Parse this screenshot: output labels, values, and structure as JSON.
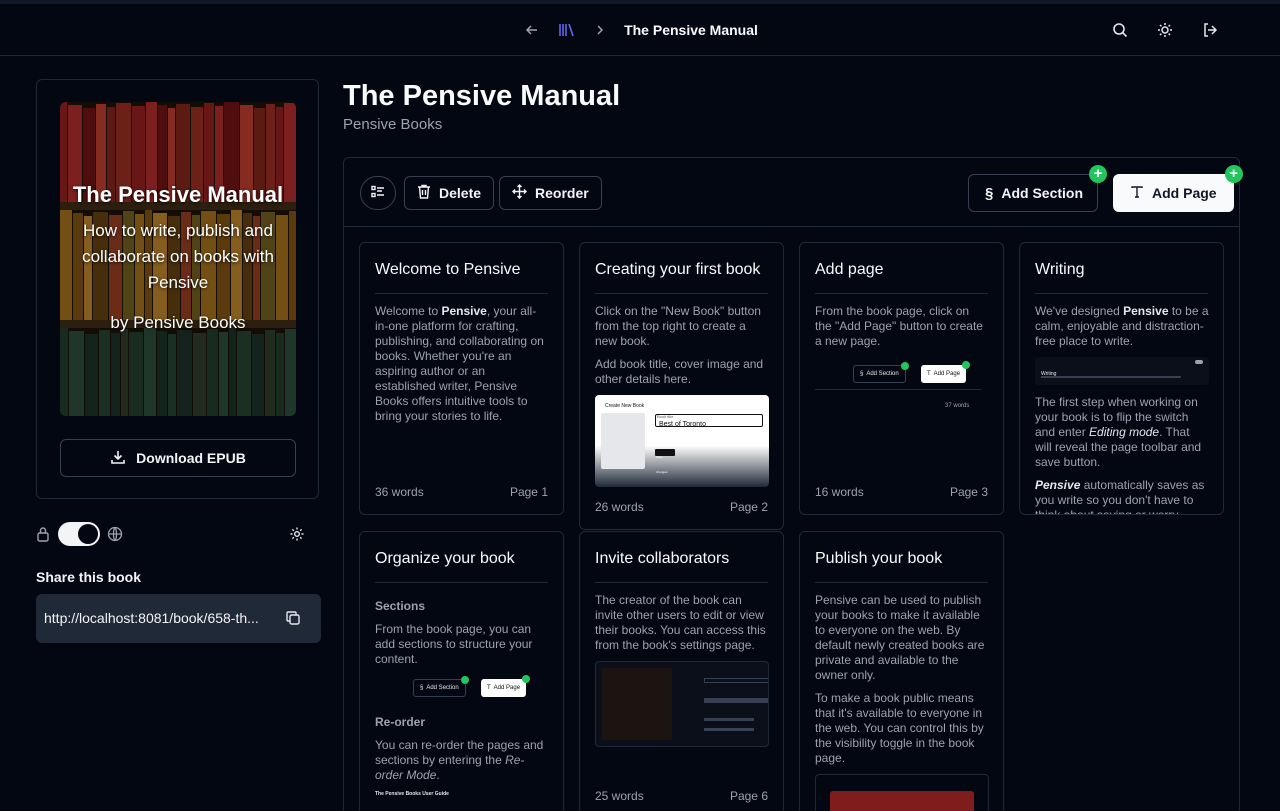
{
  "header": {
    "book_title": "The Pensive Manual",
    "icons": [
      "arrow-left-icon",
      "library-icon",
      "chevron-right-icon",
      "search-icon",
      "sun-icon",
      "logout-icon"
    ]
  },
  "sidebar": {
    "cover": {
      "title": "The Pensive Manual",
      "subtitle": "How to write, publish and collaborate on books with Pensive",
      "byline": "by Pensive Books"
    },
    "download_label": "Download EPUB",
    "share_label": "Share this book",
    "share_url": "http://localhost:8081/book/658-th..."
  },
  "main": {
    "title": "The Pensive Manual",
    "author": "Pensive Books",
    "toolbar": {
      "delete_label": "Delete",
      "reorder_label": "Reorder",
      "add_section_label": "Add Section",
      "add_page_label": "Add Page"
    },
    "cards": [
      {
        "title": "Welcome to Pensive",
        "words": "36 words",
        "page": "Page 1",
        "p1_pre": "Welcome to ",
        "p1_bold": "Pensive",
        "p1_post": ", your all-in-one platform for crafting, publishing, and collaborating on books. Whether you're an aspiring author or an established writer, Pensive Books offers intuitive tools to bring your stories to life."
      },
      {
        "title": "Creating your first book",
        "words": "26 words",
        "page": "Page 2",
        "p1": "Click on the \"New Book\" button from the top right to create a new book.",
        "p2": "Add book title, cover image and other details here.",
        "shot_header": "Create New Book",
        "shot_title_label": "Book title",
        "shot_title_value": "Best of Toronto",
        "shot_btn": "Save changes"
      },
      {
        "title": "Add page",
        "words": "16 words",
        "page": "Page 3",
        "p1": "From the book page, click on the \"Add Page\" button to create a new page.",
        "shot_add_section": "Add Section",
        "shot_add_page": "Add Page",
        "shot_words": "37 words"
      },
      {
        "title": "Writing",
        "p1_pre": "We've designed ",
        "p1_bold": "Pensive",
        "p1_post": " to be a calm, enjoyable and distraction-free place to write.",
        "shot_title": "Writing",
        "p2_pre": "The first step when working on your book is to flip the switch and enter ",
        "p2_em": "Editing mode",
        "p2_post": ". That will reveal the page toolbar and save button.",
        "p3_bold": "Pensive",
        "p3_post": " automatically saves as you write so you don't have to think about saving or worry..."
      },
      {
        "title": "Organize your book",
        "h1": "Sections",
        "p1": "From the book page, you can add sections to structure your content.",
        "shot_add_section": "Add Section",
        "shot_add_page": "Add Page",
        "h2": "Re-order",
        "p2_pre": "You can re-order the pages and sections by entering the ",
        "p2_em": "Re-order Mode",
        "p2_post": ".",
        "shot2_title": "The Pensive Books User Guide"
      },
      {
        "title": "Invite collaborators",
        "words": "25 words",
        "page": "Page 6",
        "p1": "The creator of the book can invite other users to edit or view their books. You can access this from the book's settings page."
      },
      {
        "title": "Publish your book",
        "p1": "Pensive can be used to publish your books to make it available to everyone on the web. By default newly created books are private and available to the owner only.",
        "p2": "To make a book public means that it's available to everyone in the web. You can control this by the visibility toggle in the book page."
      }
    ]
  },
  "colors": {
    "background": "#030712",
    "border": "#1f2937",
    "accent_green": "#22c55e",
    "library_icon": "#6366f1"
  }
}
